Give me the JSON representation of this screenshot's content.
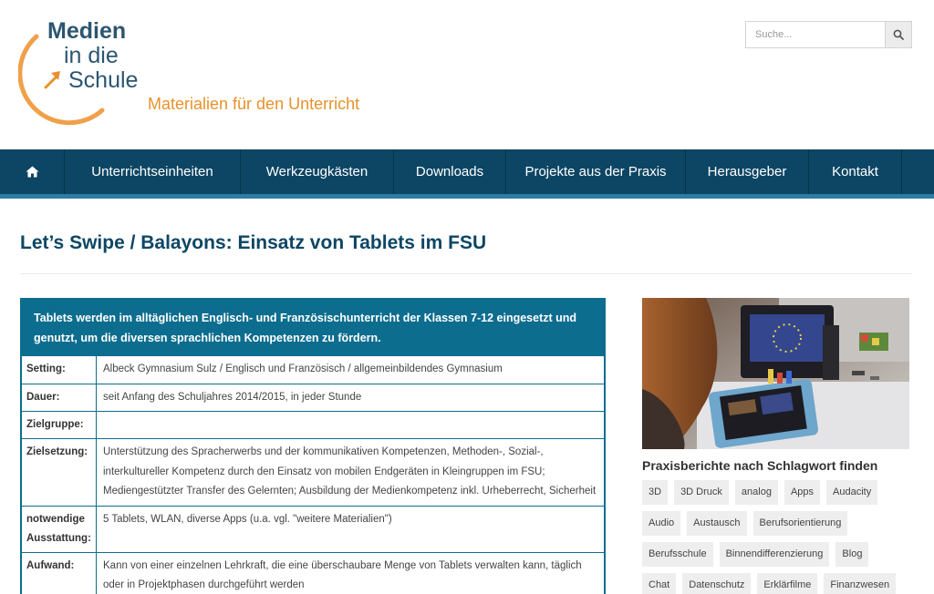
{
  "logo": {
    "line1": "Medien",
    "line2": "in die",
    "line3": "Schule",
    "tagline": "Materialien für den Unterricht"
  },
  "search": {
    "placeholder": "Suche..."
  },
  "nav": {
    "items": [
      "Unterrichtseinheiten",
      "Werkzeugkästen",
      "Downloads",
      "Projekte aus der Praxis",
      "Herausgeber",
      "Kontakt"
    ]
  },
  "page": {
    "title": "Let’s Swipe / Balayons: Einsatz von Tablets im FSU"
  },
  "info": {
    "intro": "Tablets werden im alltäglichen Englisch- und Französischunterricht der Klassen 7-12 eingesetzt und genutzt, um die diversen sprachlichen Kompetenzen zu fördern.",
    "rows": [
      {
        "label": "Setting:",
        "value": "Albeck Gymnasium Sulz / Englisch und Französisch / allgemeinbildendes Gymnasium"
      },
      {
        "label": "Dauer:",
        "value": "seit Anfang des Schuljahres 2014/2015, in jeder Stunde"
      },
      {
        "label": "Zielgruppe:",
        "value": ""
      },
      {
        "label": "Zielsetzung:",
        "value": "Unterstützung des Spracherwerbs und der kommunikativen Kompetenzen, Methoden-, Sozial-, interkultureller Kompetenz durch den Einsatz von mobilen Endgeräten in Kleingruppen im FSU; Mediengestützter Transfer des Gelernten; Ausbildung der Medienkompetenz inkl. Urheberrecht, Sicherheit"
      },
      {
        "label": "notwendige Ausstattung:",
        "value": "5 Tablets, WLAN, diverse Apps (u.a. vgl. \"weitere Materialien\")"
      },
      {
        "label": "Aufwand:",
        "value": "Kann von einer einzelnen Lehrkraft, die eine überschaubare Menge von Tablets verwalten kann, täglich oder in Projektphasen durchgeführt werden"
      }
    ]
  },
  "sidebar": {
    "heading": "Praxisberichte nach Schlagwort finden",
    "tag_rows": [
      [
        "3D",
        "3D Druck",
        "analog",
        "Apps",
        "Audacity"
      ],
      [
        "Audio",
        "Austausch",
        "Berufsorientierung"
      ],
      [
        "Berufsschule",
        "Binnendifferenzierung",
        "Blog"
      ],
      [
        "Chat",
        "Datenschutz",
        "Erklärfilme",
        "Finanzwesen"
      ]
    ]
  },
  "colors": {
    "nav_bg": "#0d4664",
    "accent_blue": "#0d6d8e",
    "logo_orange": "#e8912c",
    "logo_blue": "#2c5670"
  }
}
